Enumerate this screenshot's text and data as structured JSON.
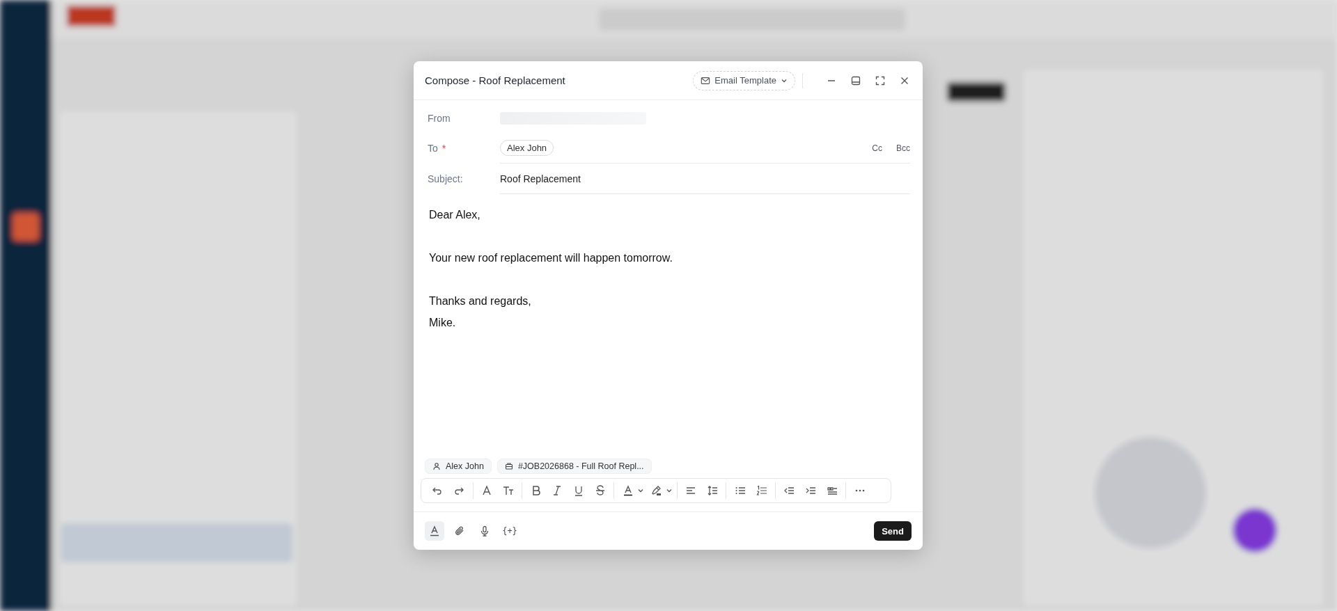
{
  "dialog": {
    "title": "Compose - Roof Replacement",
    "template_button": "Email Template",
    "from": {
      "label": "From"
    },
    "to": {
      "label": "To",
      "required_mark": "*",
      "recipients": [
        "Alex John"
      ],
      "cc": "Cc",
      "bcc": "Bcc"
    },
    "subject": {
      "label": "Subject:",
      "value": "Roof Replacement"
    },
    "body": [
      {
        "lines": [
          "Dear Alex,"
        ]
      },
      {
        "lines": [
          "Your new roof replacement will happen tomorrow."
        ]
      },
      {
        "lines": [
          "Thanks and regards,",
          "Mike."
        ]
      }
    ],
    "linked": [
      {
        "kind": "contact",
        "label": "Alex John"
      },
      {
        "kind": "job",
        "label": "#JOB2026868 - Full Roof Repl..."
      }
    ],
    "footer_tools": [
      {
        "kind": "format",
        "selected": true
      },
      {
        "kind": "attach",
        "selected": false
      },
      {
        "kind": "mic",
        "selected": false
      },
      {
        "kind": "variable",
        "label": "{+}",
        "selected": false
      }
    ],
    "send": "Send"
  }
}
